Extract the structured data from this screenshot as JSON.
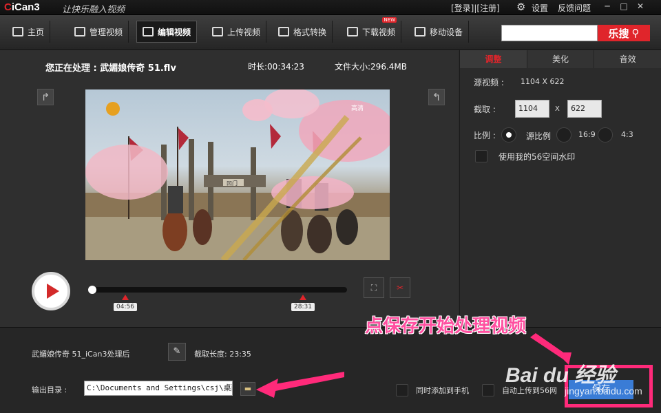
{
  "title_bar": {
    "app_name": "iCan3",
    "slogan": "让快乐融入视频",
    "login": "[登录]|[注册]",
    "settings": "设置",
    "feedback": "反馈问题",
    "minimize": "─",
    "maximize": "□",
    "close": "✕"
  },
  "nav": {
    "items": [
      {
        "label": "主页",
        "icon": "home-icon"
      },
      {
        "label": "管理视频",
        "icon": "manage-video-icon"
      },
      {
        "label": "编辑视频",
        "icon": "edit-video-icon",
        "active": true
      },
      {
        "label": "上传视频",
        "icon": "upload-icon"
      },
      {
        "label": "格式转换",
        "icon": "convert-icon"
      },
      {
        "label": "下载视频",
        "icon": "download-icon",
        "badge": "NEW"
      },
      {
        "label": "移动设备",
        "icon": "mobile-device-icon"
      }
    ],
    "search_value": "",
    "search_button": "乐搜"
  },
  "video": {
    "processing_label": "您正在处理 : 武媚娘传奇 51.flv",
    "duration": "时长:00:34:23",
    "file_size": "文件大小:296.4MB",
    "channel_logo": "高清",
    "sign_text": "凹门",
    "markers": {
      "start": "04:56",
      "end": "28:31"
    }
  },
  "panel": {
    "tabs": [
      "调整",
      "美化",
      "音效"
    ],
    "source_label": "源视频 :",
    "source_value": "1104 X 622",
    "crop_label": "截取 :",
    "crop_width": "1104",
    "crop_x": "X",
    "crop_height": "622",
    "ratio_label": "比例 :",
    "ratio_options": [
      "源比例",
      "16:9",
      "4:3"
    ],
    "ratio_selected": "源比例",
    "watermark_label": "使用我的56空间水印"
  },
  "bottom": {
    "output_name": "武媚娘传奇 51_iCan3处理后",
    "cut_length": "截取长度: 23:35",
    "output_dir_label": "输出目录 :",
    "output_dir_value": "C:\\Documents and Settings\\csj\\桌面",
    "add_to_phone": "同时添加到手机",
    "auto_upload": "自动上传到56网",
    "save": "保存"
  },
  "annotation": {
    "text": "点保存开始处理视频",
    "color": "#ff2a7a"
  },
  "watermark": {
    "brand": "Bai du 经验",
    "url": "jingyan.baidu.com"
  }
}
